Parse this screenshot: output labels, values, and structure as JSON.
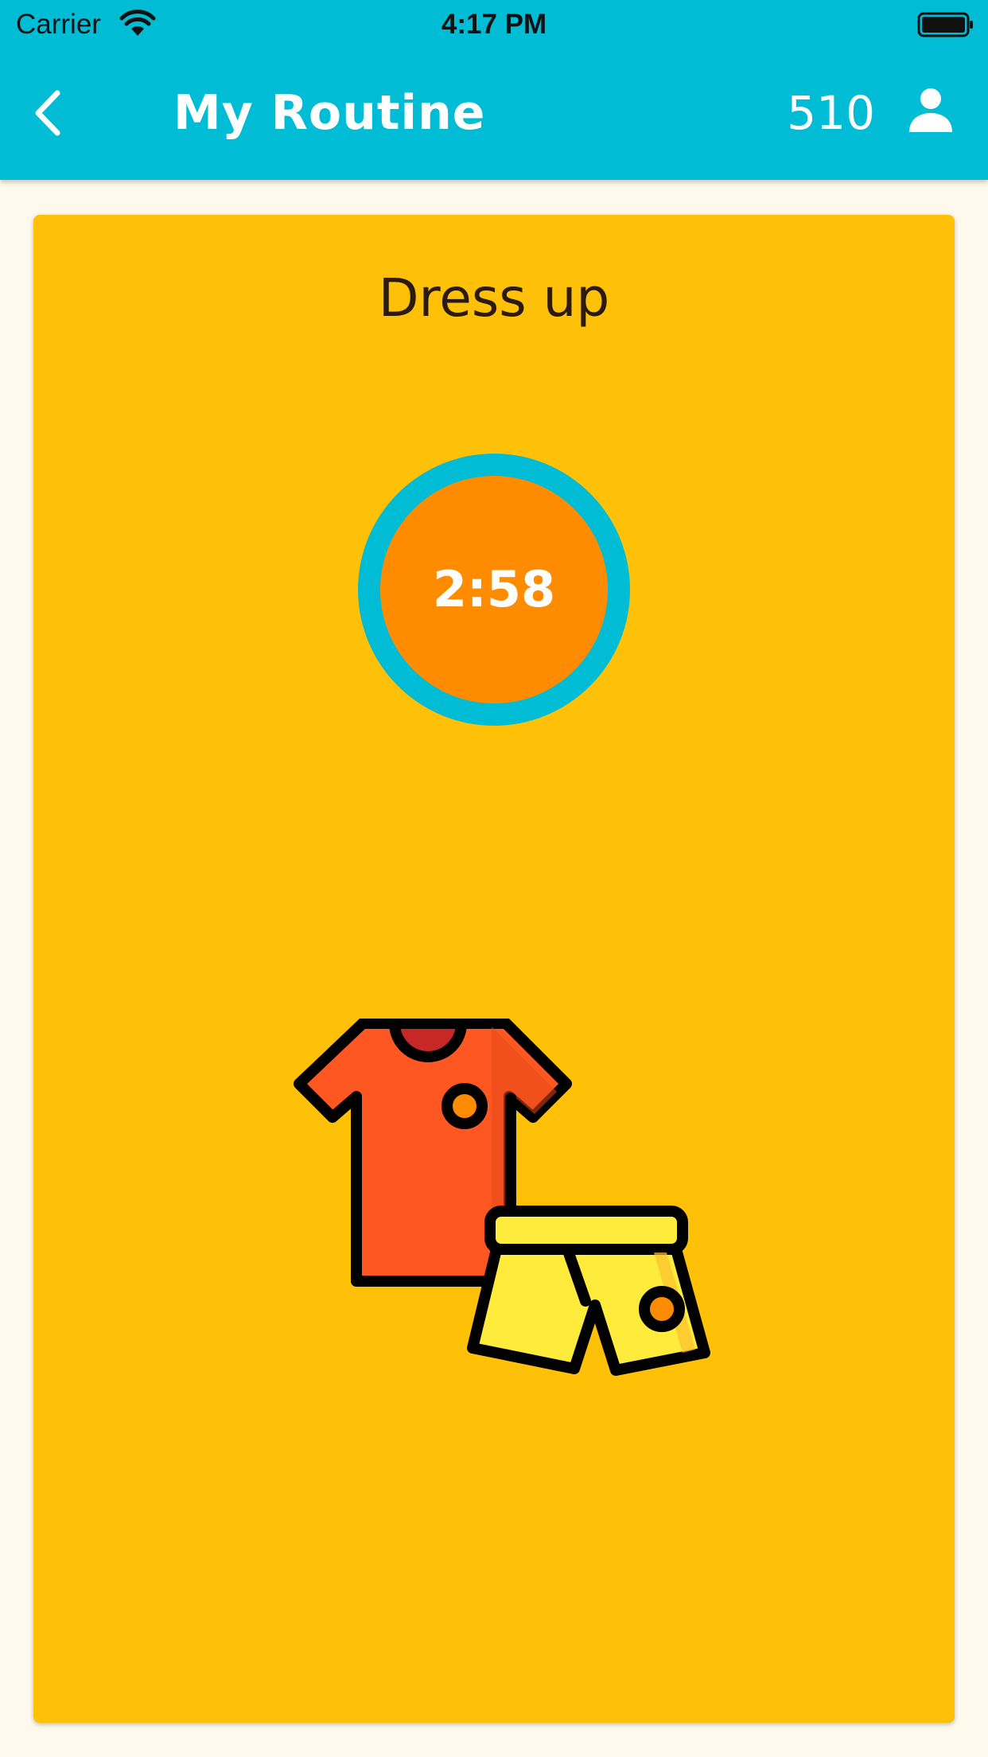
{
  "status_bar": {
    "carrier": "Carrier",
    "time": "4:17 PM",
    "wifi_icon": "wifi-icon",
    "battery_icon": "battery-icon"
  },
  "nav": {
    "back_icon": "chevron-left-icon",
    "title": "My Routine",
    "points": "510",
    "profile_icon": "person-icon"
  },
  "task": {
    "title": "Dress up",
    "timer": "2:58",
    "illustration_icon": "clothes-icon"
  },
  "colors": {
    "nav_background": "#00BCD4",
    "page_background": "#FDF9EC",
    "card_background": "#FFC107",
    "timer_ring": "#00BCD4",
    "timer_core": "#FF8C00",
    "shirt": "#FF5722",
    "shorts": "#FFEB3B"
  }
}
